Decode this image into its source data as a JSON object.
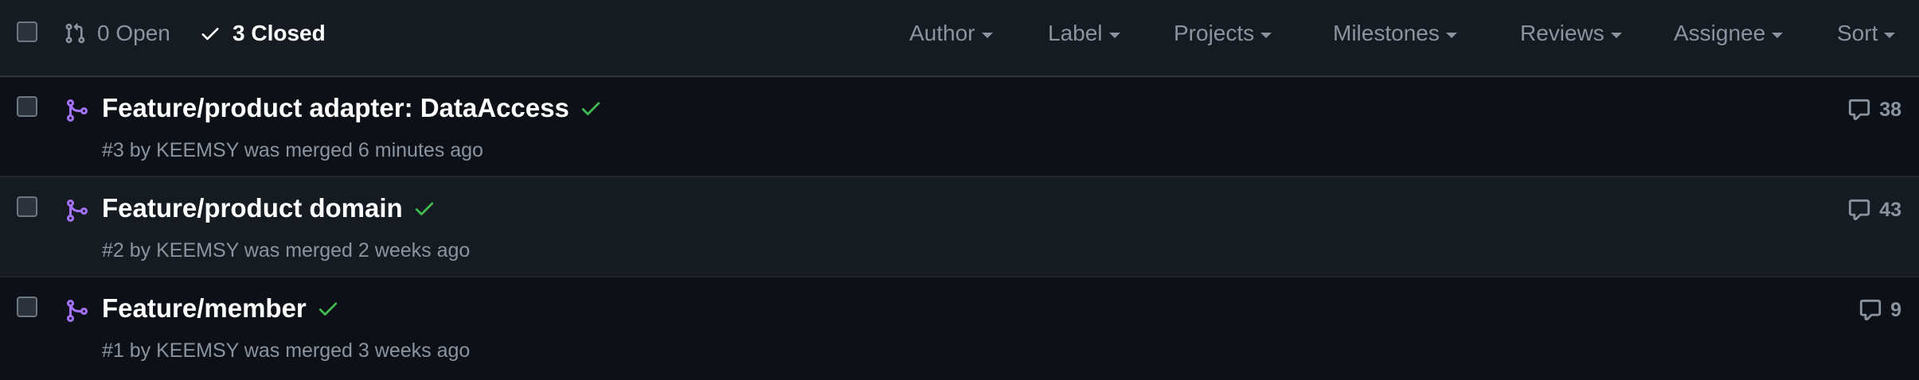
{
  "header": {
    "open_label": "0 Open",
    "closed_label": "3 Closed",
    "filters": [
      "Author",
      "Label",
      "Projects",
      "Milestones",
      "Reviews",
      "Assignee",
      "Sort"
    ]
  },
  "pull_requests": [
    {
      "title": "Feature/product adapter: DataAccess",
      "meta": "#3 by KEEMSY was merged 6 minutes ago",
      "comments": "38"
    },
    {
      "title": "Feature/product domain",
      "meta": "#2 by KEEMSY was merged 2 weeks ago",
      "comments": "43"
    },
    {
      "title": "Feature/member",
      "meta": "#1 by KEEMSY was merged 3 weeks ago",
      "comments": "9"
    }
  ],
  "colors": {
    "background": "#0d1117",
    "header_bg": "#161b22",
    "merged_purple": "#a371f7",
    "success_green": "#3fb950",
    "muted_text": "#8b949e"
  },
  "icons": {
    "open_state": "git-pull-request-icon",
    "closed_state": "check-icon",
    "pr_status": "git-merge-icon",
    "ci_status": "check-icon",
    "comments": "comment-icon"
  }
}
